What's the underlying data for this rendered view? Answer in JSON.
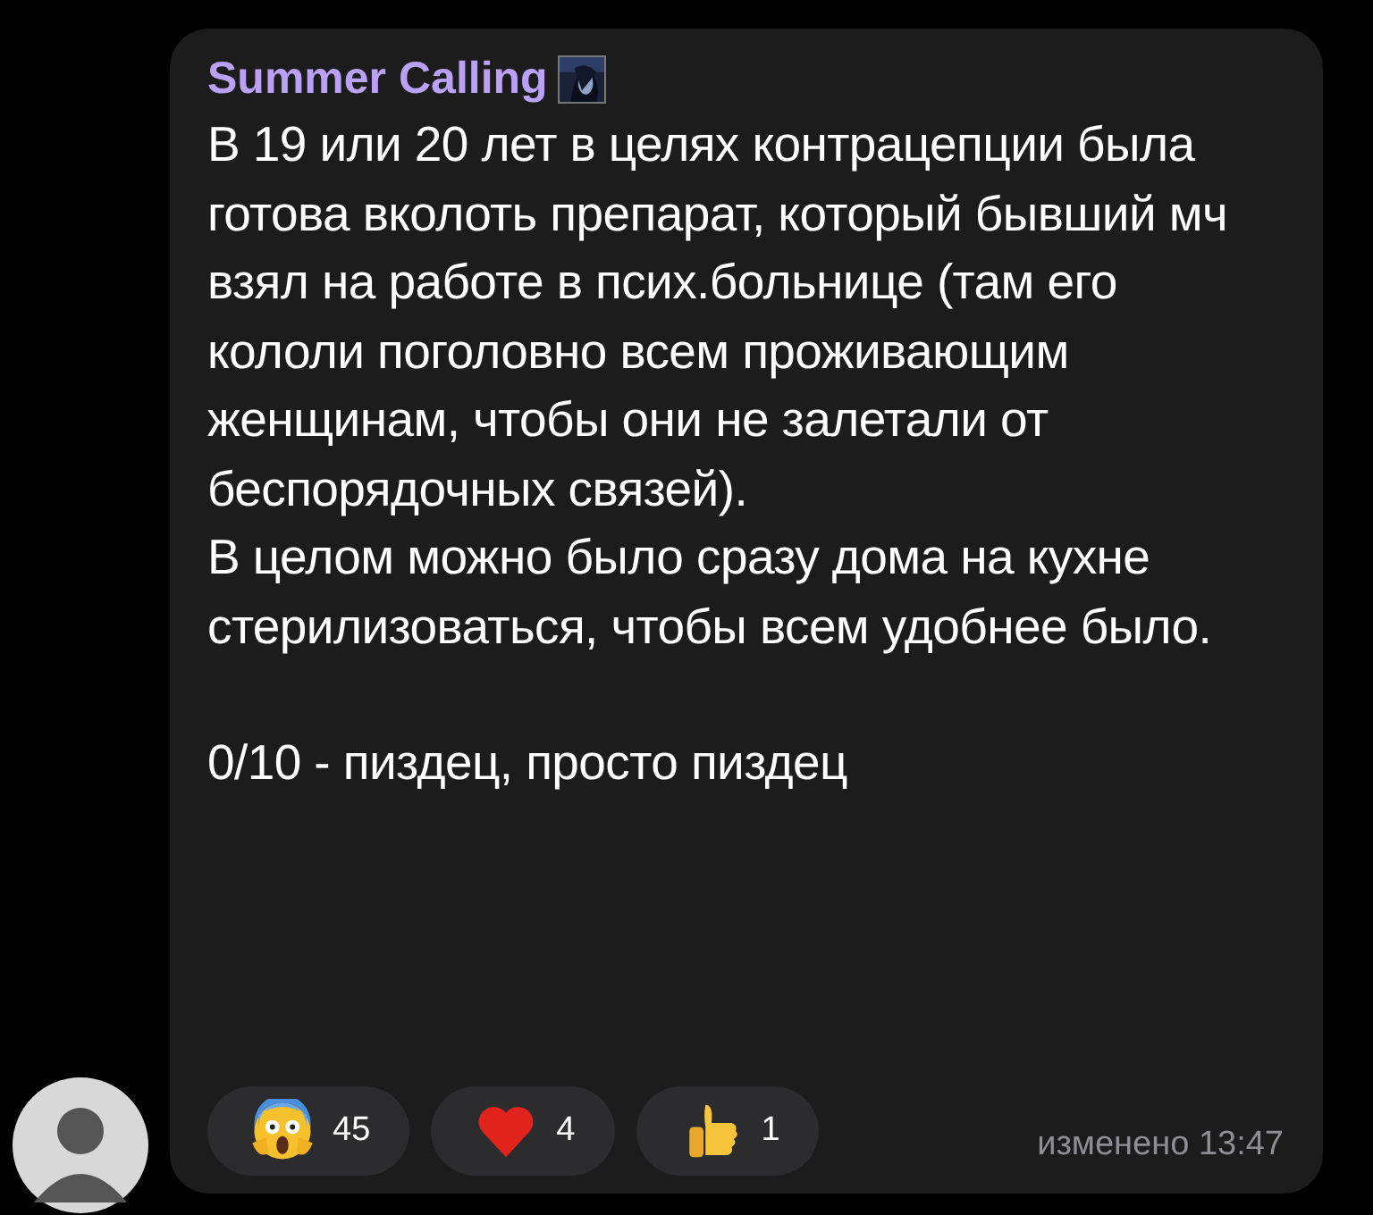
{
  "message": {
    "sender": "Summer Calling",
    "paragraphs": [
      "В 19 или 20 лет в целях контрацепции была готова вколоть препарат, который бывший мч взял на работе в псих.больнице (там его кололи поголовно всем проживающим женщинам, чтобы они не залетали от беспорядочных связей).",
      "В целом можно было сразу дома на кухне стерилизоваться, чтобы всем удобнее было.",
      "0/10 - пиздец, просто пиздец"
    ],
    "reactions": [
      {
        "kind": "scream",
        "count": "45"
      },
      {
        "kind": "heart",
        "count": "4"
      },
      {
        "kind": "thumbs-up",
        "count": "1"
      }
    ],
    "edited_time": "изменено 13:47"
  }
}
